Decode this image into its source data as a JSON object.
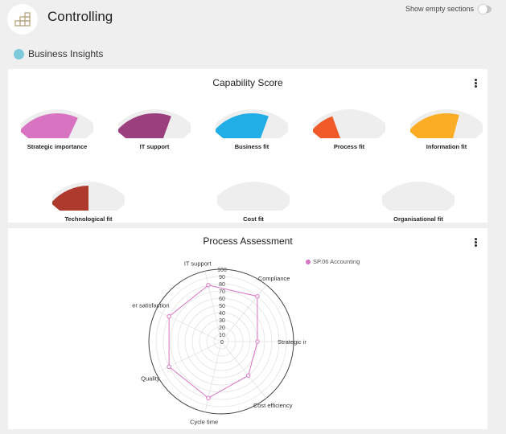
{
  "header": {
    "title": "Controlling",
    "app_icon": "stairs-chart-icon",
    "toggle_label": "Show empty sections",
    "toggle_on": false
  },
  "section": {
    "title": "Business Insights",
    "dot_color": "#7ec8dc"
  },
  "capability_card": {
    "title": "Capability Score",
    "menu_icon": "kebab-menu-icon",
    "gauges": [
      {
        "label": "Strategic importance",
        "value": 0.75,
        "color": "#d873c2"
      },
      {
        "label": "IT support",
        "value": 0.7,
        "color": "#9c3f7e"
      },
      {
        "label": "Business fit",
        "value": 0.7,
        "color": "#21ade6"
      },
      {
        "label": "Process fit",
        "value": 0.3,
        "color": "#f05a28"
      },
      {
        "label": "Information fit",
        "value": 0.65,
        "color": "#fbad25"
      },
      {
        "label": "Technological fit",
        "value": 0.5,
        "color": "#ae3a2e"
      },
      {
        "label": "Cost fit",
        "value": 0,
        "color": "#eeeeee"
      },
      {
        "label": "Organisational fit",
        "value": 0,
        "color": "#eeeeee"
      }
    ],
    "track_color": "#eeeeee"
  },
  "process_card": {
    "title": "Process Assessment",
    "menu_icon": "kebab-menu-icon"
  },
  "chart_data": {
    "type": "radar",
    "title": "Process Assessment",
    "axes": [
      "Strategic importance",
      "Compliance",
      "IT support",
      "Customer satisfaction",
      "Quality",
      "Cycle time",
      "Cost efficiency"
    ],
    "axis_display_labels": [
      "Strategic ir",
      "Compliance",
      "IT support",
      "er satisfaction",
      "Quality",
      "Cycle time",
      "Cost efficiency"
    ],
    "r_range": [
      0,
      100
    ],
    "r_ticks": [
      0,
      10,
      20,
      30,
      40,
      50,
      60,
      70,
      80,
      90,
      100
    ],
    "grid": true,
    "legend_position": "top-right",
    "series": [
      {
        "name": "SP.06 Accounting",
        "color": "#d873c2",
        "values": [
          50,
          80,
          80,
          80,
          80,
          80,
          60
        ]
      }
    ]
  }
}
